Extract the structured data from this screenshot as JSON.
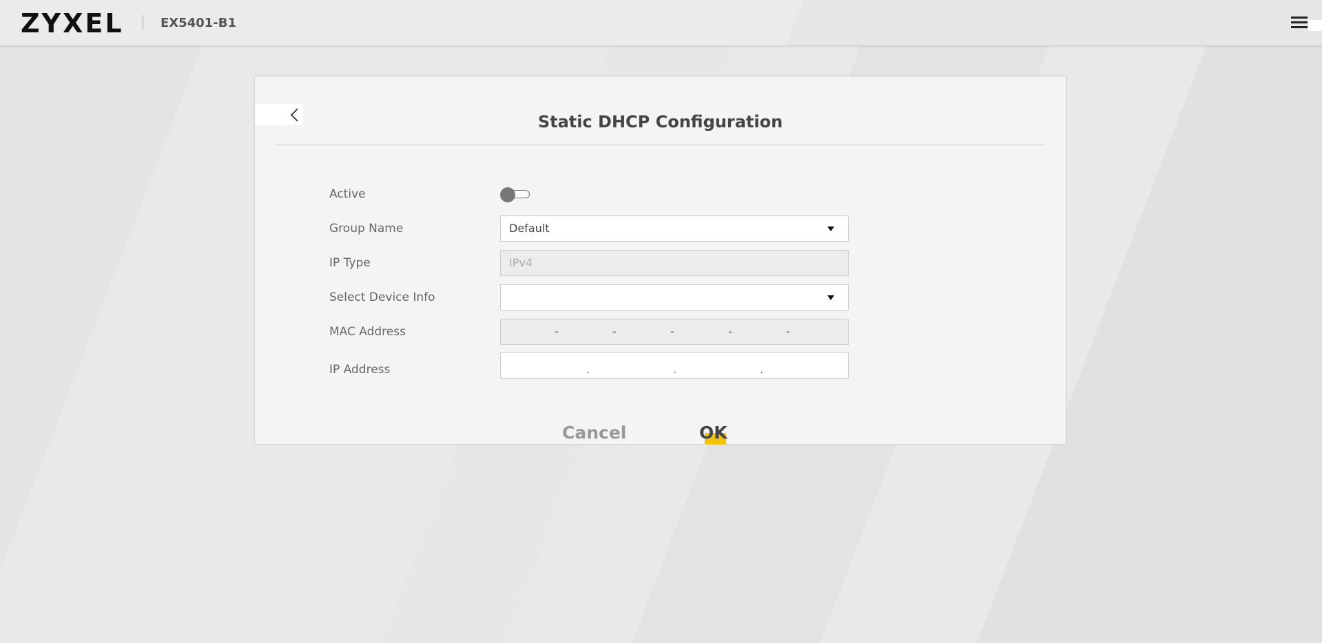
{
  "header": {
    "logo": "ZYXEL",
    "model": "EX5401-B1",
    "menu_icon": "hamburger-menu-icon"
  },
  "panel": {
    "title": "Static DHCP Configuration",
    "back_icon": "chevron-left-icon",
    "fields": {
      "active": {
        "label": "Active",
        "value": false
      },
      "group_name": {
        "label": "Group Name",
        "value": "Default"
      },
      "ip_type": {
        "label": "IP Type",
        "value": "IPv4"
      },
      "select_device_info": {
        "label": "Select Device Info",
        "value": ""
      },
      "mac_address": {
        "label": "MAC Address",
        "separator": "-"
      },
      "ip_address": {
        "label": "IP Address",
        "separator": "."
      }
    },
    "buttons": {
      "cancel": "Cancel",
      "ok": "OK"
    },
    "accent_color": "#f5c400"
  }
}
